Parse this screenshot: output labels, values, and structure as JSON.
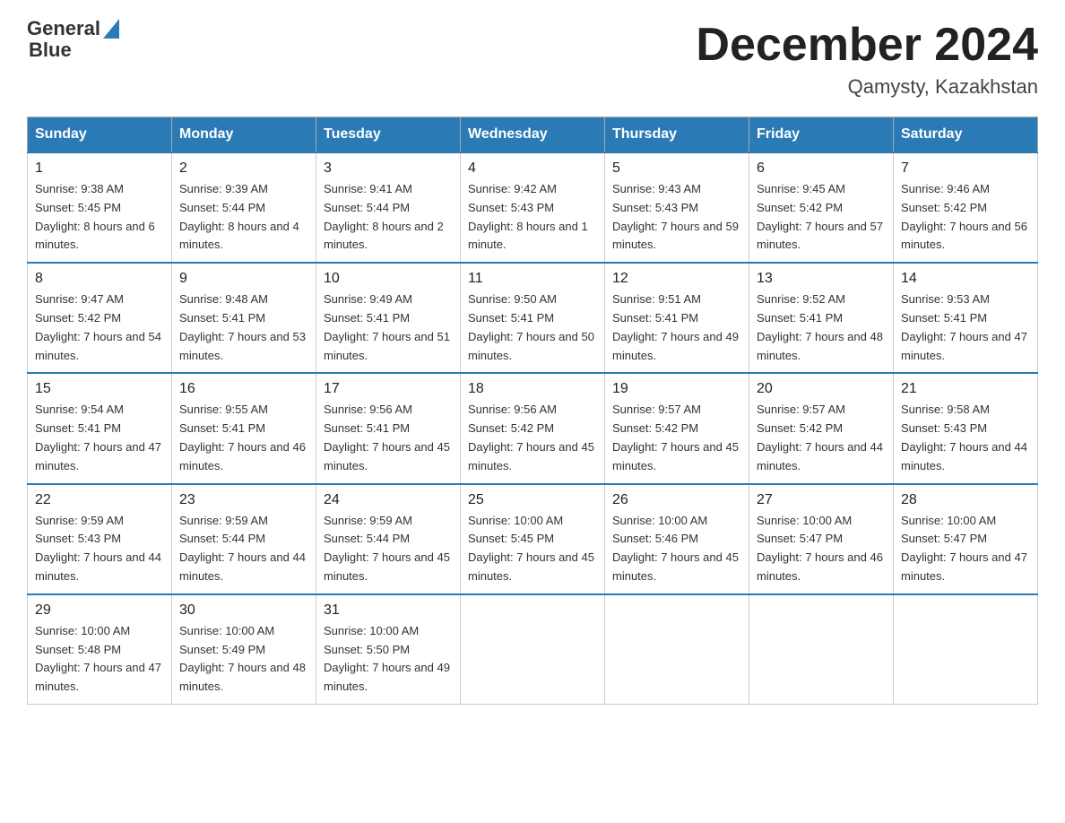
{
  "header": {
    "logo_text_general": "General",
    "logo_text_blue": "Blue",
    "main_title": "December 2024",
    "subtitle": "Qamysty, Kazakhstan"
  },
  "columns": [
    "Sunday",
    "Monday",
    "Tuesday",
    "Wednesday",
    "Thursday",
    "Friday",
    "Saturday"
  ],
  "weeks": [
    [
      {
        "day": "1",
        "sunrise": "Sunrise: 9:38 AM",
        "sunset": "Sunset: 5:45 PM",
        "daylight": "Daylight: 8 hours and 6 minutes."
      },
      {
        "day": "2",
        "sunrise": "Sunrise: 9:39 AM",
        "sunset": "Sunset: 5:44 PM",
        "daylight": "Daylight: 8 hours and 4 minutes."
      },
      {
        "day": "3",
        "sunrise": "Sunrise: 9:41 AM",
        "sunset": "Sunset: 5:44 PM",
        "daylight": "Daylight: 8 hours and 2 minutes."
      },
      {
        "day": "4",
        "sunrise": "Sunrise: 9:42 AM",
        "sunset": "Sunset: 5:43 PM",
        "daylight": "Daylight: 8 hours and 1 minute."
      },
      {
        "day": "5",
        "sunrise": "Sunrise: 9:43 AM",
        "sunset": "Sunset: 5:43 PM",
        "daylight": "Daylight: 7 hours and 59 minutes."
      },
      {
        "day": "6",
        "sunrise": "Sunrise: 9:45 AM",
        "sunset": "Sunset: 5:42 PM",
        "daylight": "Daylight: 7 hours and 57 minutes."
      },
      {
        "day": "7",
        "sunrise": "Sunrise: 9:46 AM",
        "sunset": "Sunset: 5:42 PM",
        "daylight": "Daylight: 7 hours and 56 minutes."
      }
    ],
    [
      {
        "day": "8",
        "sunrise": "Sunrise: 9:47 AM",
        "sunset": "Sunset: 5:42 PM",
        "daylight": "Daylight: 7 hours and 54 minutes."
      },
      {
        "day": "9",
        "sunrise": "Sunrise: 9:48 AM",
        "sunset": "Sunset: 5:41 PM",
        "daylight": "Daylight: 7 hours and 53 minutes."
      },
      {
        "day": "10",
        "sunrise": "Sunrise: 9:49 AM",
        "sunset": "Sunset: 5:41 PM",
        "daylight": "Daylight: 7 hours and 51 minutes."
      },
      {
        "day": "11",
        "sunrise": "Sunrise: 9:50 AM",
        "sunset": "Sunset: 5:41 PM",
        "daylight": "Daylight: 7 hours and 50 minutes."
      },
      {
        "day": "12",
        "sunrise": "Sunrise: 9:51 AM",
        "sunset": "Sunset: 5:41 PM",
        "daylight": "Daylight: 7 hours and 49 minutes."
      },
      {
        "day": "13",
        "sunrise": "Sunrise: 9:52 AM",
        "sunset": "Sunset: 5:41 PM",
        "daylight": "Daylight: 7 hours and 48 minutes."
      },
      {
        "day": "14",
        "sunrise": "Sunrise: 9:53 AM",
        "sunset": "Sunset: 5:41 PM",
        "daylight": "Daylight: 7 hours and 47 minutes."
      }
    ],
    [
      {
        "day": "15",
        "sunrise": "Sunrise: 9:54 AM",
        "sunset": "Sunset: 5:41 PM",
        "daylight": "Daylight: 7 hours and 47 minutes."
      },
      {
        "day": "16",
        "sunrise": "Sunrise: 9:55 AM",
        "sunset": "Sunset: 5:41 PM",
        "daylight": "Daylight: 7 hours and 46 minutes."
      },
      {
        "day": "17",
        "sunrise": "Sunrise: 9:56 AM",
        "sunset": "Sunset: 5:41 PM",
        "daylight": "Daylight: 7 hours and 45 minutes."
      },
      {
        "day": "18",
        "sunrise": "Sunrise: 9:56 AM",
        "sunset": "Sunset: 5:42 PM",
        "daylight": "Daylight: 7 hours and 45 minutes."
      },
      {
        "day": "19",
        "sunrise": "Sunrise: 9:57 AM",
        "sunset": "Sunset: 5:42 PM",
        "daylight": "Daylight: 7 hours and 45 minutes."
      },
      {
        "day": "20",
        "sunrise": "Sunrise: 9:57 AM",
        "sunset": "Sunset: 5:42 PM",
        "daylight": "Daylight: 7 hours and 44 minutes."
      },
      {
        "day": "21",
        "sunrise": "Sunrise: 9:58 AM",
        "sunset": "Sunset: 5:43 PM",
        "daylight": "Daylight: 7 hours and 44 minutes."
      }
    ],
    [
      {
        "day": "22",
        "sunrise": "Sunrise: 9:59 AM",
        "sunset": "Sunset: 5:43 PM",
        "daylight": "Daylight: 7 hours and 44 minutes."
      },
      {
        "day": "23",
        "sunrise": "Sunrise: 9:59 AM",
        "sunset": "Sunset: 5:44 PM",
        "daylight": "Daylight: 7 hours and 44 minutes."
      },
      {
        "day": "24",
        "sunrise": "Sunrise: 9:59 AM",
        "sunset": "Sunset: 5:44 PM",
        "daylight": "Daylight: 7 hours and 45 minutes."
      },
      {
        "day": "25",
        "sunrise": "Sunrise: 10:00 AM",
        "sunset": "Sunset: 5:45 PM",
        "daylight": "Daylight: 7 hours and 45 minutes."
      },
      {
        "day": "26",
        "sunrise": "Sunrise: 10:00 AM",
        "sunset": "Sunset: 5:46 PM",
        "daylight": "Daylight: 7 hours and 45 minutes."
      },
      {
        "day": "27",
        "sunrise": "Sunrise: 10:00 AM",
        "sunset": "Sunset: 5:47 PM",
        "daylight": "Daylight: 7 hours and 46 minutes."
      },
      {
        "day": "28",
        "sunrise": "Sunrise: 10:00 AM",
        "sunset": "Sunset: 5:47 PM",
        "daylight": "Daylight: 7 hours and 47 minutes."
      }
    ],
    [
      {
        "day": "29",
        "sunrise": "Sunrise: 10:00 AM",
        "sunset": "Sunset: 5:48 PM",
        "daylight": "Daylight: 7 hours and 47 minutes."
      },
      {
        "day": "30",
        "sunrise": "Sunrise: 10:00 AM",
        "sunset": "Sunset: 5:49 PM",
        "daylight": "Daylight: 7 hours and 48 minutes."
      },
      {
        "day": "31",
        "sunrise": "Sunrise: 10:00 AM",
        "sunset": "Sunset: 5:50 PM",
        "daylight": "Daylight: 7 hours and 49 minutes."
      },
      null,
      null,
      null,
      null
    ]
  ]
}
